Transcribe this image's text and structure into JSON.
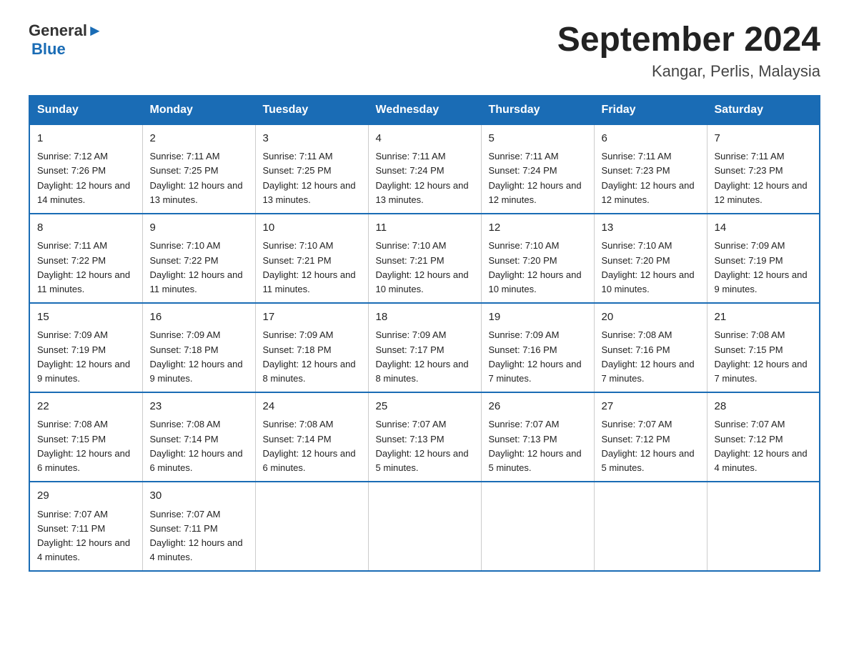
{
  "header": {
    "logo_text_general": "General",
    "logo_text_blue": "Blue",
    "month_title": "September 2024",
    "location": "Kangar, Perlis, Malaysia"
  },
  "days_of_week": [
    "Sunday",
    "Monday",
    "Tuesday",
    "Wednesday",
    "Thursday",
    "Friday",
    "Saturday"
  ],
  "weeks": [
    [
      {
        "day": "1",
        "sunrise": "Sunrise: 7:12 AM",
        "sunset": "Sunset: 7:26 PM",
        "daylight": "Daylight: 12 hours and 14 minutes."
      },
      {
        "day": "2",
        "sunrise": "Sunrise: 7:11 AM",
        "sunset": "Sunset: 7:25 PM",
        "daylight": "Daylight: 12 hours and 13 minutes."
      },
      {
        "day": "3",
        "sunrise": "Sunrise: 7:11 AM",
        "sunset": "Sunset: 7:25 PM",
        "daylight": "Daylight: 12 hours and 13 minutes."
      },
      {
        "day": "4",
        "sunrise": "Sunrise: 7:11 AM",
        "sunset": "Sunset: 7:24 PM",
        "daylight": "Daylight: 12 hours and 13 minutes."
      },
      {
        "day": "5",
        "sunrise": "Sunrise: 7:11 AM",
        "sunset": "Sunset: 7:24 PM",
        "daylight": "Daylight: 12 hours and 12 minutes."
      },
      {
        "day": "6",
        "sunrise": "Sunrise: 7:11 AM",
        "sunset": "Sunset: 7:23 PM",
        "daylight": "Daylight: 12 hours and 12 minutes."
      },
      {
        "day": "7",
        "sunrise": "Sunrise: 7:11 AM",
        "sunset": "Sunset: 7:23 PM",
        "daylight": "Daylight: 12 hours and 12 minutes."
      }
    ],
    [
      {
        "day": "8",
        "sunrise": "Sunrise: 7:11 AM",
        "sunset": "Sunset: 7:22 PM",
        "daylight": "Daylight: 12 hours and 11 minutes."
      },
      {
        "day": "9",
        "sunrise": "Sunrise: 7:10 AM",
        "sunset": "Sunset: 7:22 PM",
        "daylight": "Daylight: 12 hours and 11 minutes."
      },
      {
        "day": "10",
        "sunrise": "Sunrise: 7:10 AM",
        "sunset": "Sunset: 7:21 PM",
        "daylight": "Daylight: 12 hours and 11 minutes."
      },
      {
        "day": "11",
        "sunrise": "Sunrise: 7:10 AM",
        "sunset": "Sunset: 7:21 PM",
        "daylight": "Daylight: 12 hours and 10 minutes."
      },
      {
        "day": "12",
        "sunrise": "Sunrise: 7:10 AM",
        "sunset": "Sunset: 7:20 PM",
        "daylight": "Daylight: 12 hours and 10 minutes."
      },
      {
        "day": "13",
        "sunrise": "Sunrise: 7:10 AM",
        "sunset": "Sunset: 7:20 PM",
        "daylight": "Daylight: 12 hours and 10 minutes."
      },
      {
        "day": "14",
        "sunrise": "Sunrise: 7:09 AM",
        "sunset": "Sunset: 7:19 PM",
        "daylight": "Daylight: 12 hours and 9 minutes."
      }
    ],
    [
      {
        "day": "15",
        "sunrise": "Sunrise: 7:09 AM",
        "sunset": "Sunset: 7:19 PM",
        "daylight": "Daylight: 12 hours and 9 minutes."
      },
      {
        "day": "16",
        "sunrise": "Sunrise: 7:09 AM",
        "sunset": "Sunset: 7:18 PM",
        "daylight": "Daylight: 12 hours and 9 minutes."
      },
      {
        "day": "17",
        "sunrise": "Sunrise: 7:09 AM",
        "sunset": "Sunset: 7:18 PM",
        "daylight": "Daylight: 12 hours and 8 minutes."
      },
      {
        "day": "18",
        "sunrise": "Sunrise: 7:09 AM",
        "sunset": "Sunset: 7:17 PM",
        "daylight": "Daylight: 12 hours and 8 minutes."
      },
      {
        "day": "19",
        "sunrise": "Sunrise: 7:09 AM",
        "sunset": "Sunset: 7:16 PM",
        "daylight": "Daylight: 12 hours and 7 minutes."
      },
      {
        "day": "20",
        "sunrise": "Sunrise: 7:08 AM",
        "sunset": "Sunset: 7:16 PM",
        "daylight": "Daylight: 12 hours and 7 minutes."
      },
      {
        "day": "21",
        "sunrise": "Sunrise: 7:08 AM",
        "sunset": "Sunset: 7:15 PM",
        "daylight": "Daylight: 12 hours and 7 minutes."
      }
    ],
    [
      {
        "day": "22",
        "sunrise": "Sunrise: 7:08 AM",
        "sunset": "Sunset: 7:15 PM",
        "daylight": "Daylight: 12 hours and 6 minutes."
      },
      {
        "day": "23",
        "sunrise": "Sunrise: 7:08 AM",
        "sunset": "Sunset: 7:14 PM",
        "daylight": "Daylight: 12 hours and 6 minutes."
      },
      {
        "day": "24",
        "sunrise": "Sunrise: 7:08 AM",
        "sunset": "Sunset: 7:14 PM",
        "daylight": "Daylight: 12 hours and 6 minutes."
      },
      {
        "day": "25",
        "sunrise": "Sunrise: 7:07 AM",
        "sunset": "Sunset: 7:13 PM",
        "daylight": "Daylight: 12 hours and 5 minutes."
      },
      {
        "day": "26",
        "sunrise": "Sunrise: 7:07 AM",
        "sunset": "Sunset: 7:13 PM",
        "daylight": "Daylight: 12 hours and 5 minutes."
      },
      {
        "day": "27",
        "sunrise": "Sunrise: 7:07 AM",
        "sunset": "Sunset: 7:12 PM",
        "daylight": "Daylight: 12 hours and 5 minutes."
      },
      {
        "day": "28",
        "sunrise": "Sunrise: 7:07 AM",
        "sunset": "Sunset: 7:12 PM",
        "daylight": "Daylight: 12 hours and 4 minutes."
      }
    ],
    [
      {
        "day": "29",
        "sunrise": "Sunrise: 7:07 AM",
        "sunset": "Sunset: 7:11 PM",
        "daylight": "Daylight: 12 hours and 4 minutes."
      },
      {
        "day": "30",
        "sunrise": "Sunrise: 7:07 AM",
        "sunset": "Sunset: 7:11 PM",
        "daylight": "Daylight: 12 hours and 4 minutes."
      },
      null,
      null,
      null,
      null,
      null
    ]
  ]
}
